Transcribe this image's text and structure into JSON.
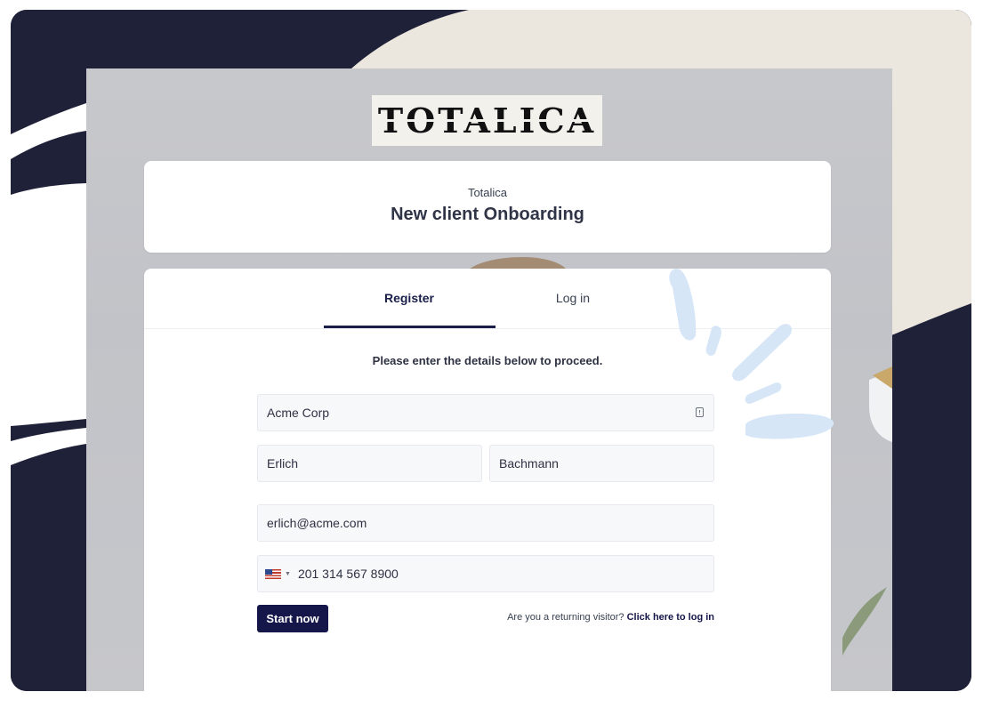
{
  "logo": {
    "text": "TOTALICA"
  },
  "header": {
    "company": "Totalica",
    "title": "New client Onboarding"
  },
  "tabs": [
    {
      "label": "Register",
      "active": true
    },
    {
      "label": "Log in",
      "active": false
    }
  ],
  "form": {
    "instructions": "Please enter the details below to proceed.",
    "company": {
      "value": "Acme Corp",
      "icon": "company-building-icon"
    },
    "first_name": {
      "value": "Erlich"
    },
    "last_name": {
      "value": "Bachmann"
    },
    "email": {
      "value": "erlich@acme.com"
    },
    "phone": {
      "country_flag": "us-flag-icon",
      "value": "201 314 567 8900"
    },
    "submit_label": "Start now",
    "returning_text": "Are you a returning visitor?",
    "login_link": "Click here to log in"
  },
  "colors": {
    "navy": "#1f2138",
    "cream": "#ebe6de",
    "accent": "#15164a",
    "sparks": "#d6e6f7"
  }
}
